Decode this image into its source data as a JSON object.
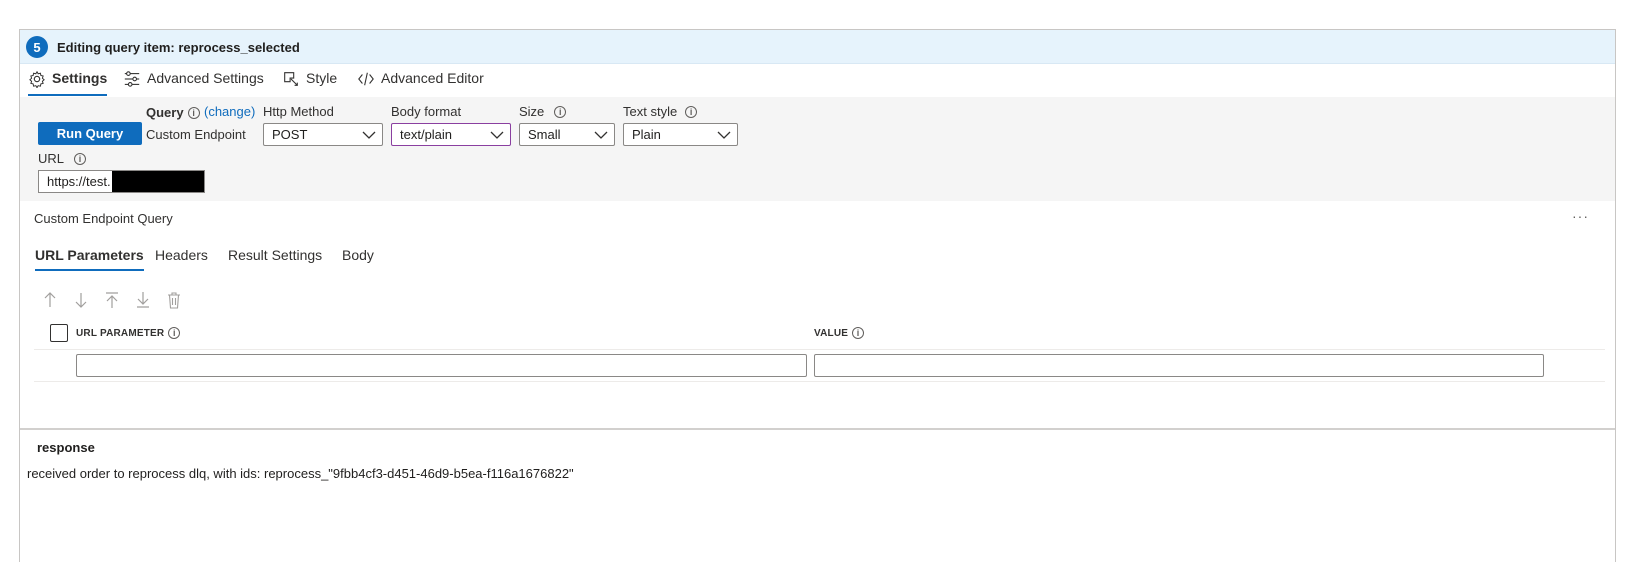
{
  "header": {
    "step": "5",
    "title": "Editing query item: reprocess_selected"
  },
  "tabs": [
    {
      "label": "Settings",
      "icon": "gear-icon"
    },
    {
      "label": "Advanced Settings",
      "icon": "sliders-icon"
    },
    {
      "label": "Style",
      "icon": "style-icon"
    },
    {
      "label": "Advanced Editor",
      "icon": "code-icon"
    }
  ],
  "settings": {
    "run_label": "Run Query",
    "query_label": "Query",
    "change_link": "(change)",
    "query_value": "Custom Endpoint",
    "http_method_label": "Http Method",
    "http_method_value": "POST",
    "body_format_label": "Body format",
    "body_format_value": "text/plain",
    "size_label": "Size",
    "size_value": "Small",
    "text_style_label": "Text style",
    "text_style_value": "Plain",
    "url_label": "URL",
    "url_value": "https://test."
  },
  "endpoint": {
    "title": "Custom Endpoint Query",
    "more": "···",
    "subtabs": [
      "URL Parameters",
      "Headers",
      "Result Settings",
      "Body"
    ],
    "toolbar_icons": [
      "arrow-up-icon",
      "arrow-down-icon",
      "move-to-top-icon",
      "move-to-bottom-icon",
      "delete-icon"
    ],
    "columns": [
      "URL PARAMETER",
      "VALUE"
    ],
    "row": {
      "param": "",
      "value": ""
    }
  },
  "response": {
    "title": "response",
    "text": "received order to reprocess dlq, with ids: reprocess_\"9fbb4cf3-d451-46d9-b5ea-f116a1676822\""
  },
  "colors": {
    "accent": "#0f6cbd",
    "header_bg": "#e6f3fc",
    "panel_bg": "#f5f5f5",
    "focus": "#8a3fa0"
  }
}
